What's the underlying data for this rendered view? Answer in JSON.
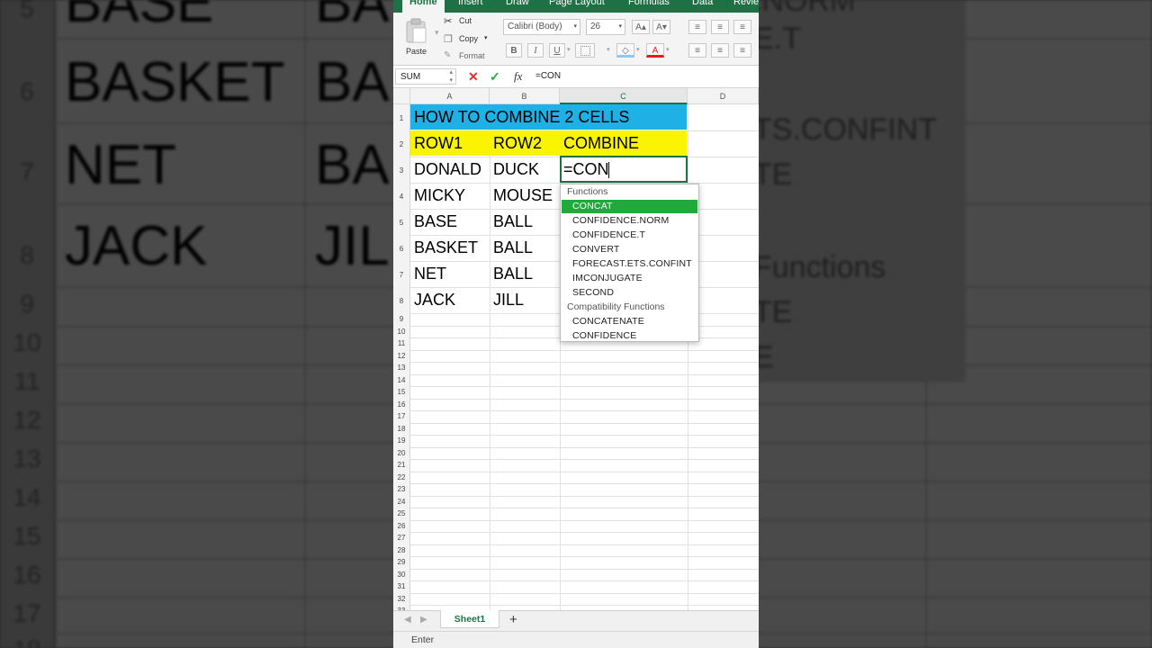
{
  "ribbon": {
    "tabs": [
      "Home",
      "Insert",
      "Draw",
      "Page Layout",
      "Formulas",
      "Data",
      "Revie"
    ],
    "active_tab": "Home",
    "paste_label": "Paste",
    "cut_label": "Cut",
    "copy_label": "Copy",
    "format_label": "Format",
    "font_name": "Calibri (Body)",
    "font_size": "26",
    "bold": "B",
    "italic": "I",
    "underline": "U",
    "grow_font": "A",
    "shrink_font": "A"
  },
  "formula_bar": {
    "name_box": "SUM",
    "cancel_icon": "✕",
    "enter_icon": "✓",
    "fx_label": "fx",
    "content": "=CON"
  },
  "grid": {
    "columns": [
      "A",
      "B",
      "C",
      "D"
    ],
    "selected_column": "C",
    "row_numbers": [
      "1",
      "2",
      "3",
      "4",
      "5",
      "6",
      "7",
      "8",
      "9",
      "10",
      "11",
      "12",
      "13",
      "14",
      "15",
      "16",
      "17",
      "18",
      "19",
      "20",
      "21",
      "22",
      "23",
      "24",
      "25",
      "26",
      "27",
      "28",
      "29",
      "30",
      "31",
      "32",
      "33"
    ],
    "title": "HOW TO COMBINE 2 CELLS",
    "header": [
      "ROW1",
      "ROW2",
      "COMBINE"
    ],
    "rows": [
      [
        "DONALD",
        "DUCK"
      ],
      [
        "MICKY",
        "MOUSE"
      ],
      [
        "BASE",
        "BALL"
      ],
      [
        "BASKET",
        "BALL"
      ],
      [
        "NET",
        "BALL"
      ],
      [
        "JACK",
        "JILL"
      ]
    ],
    "active_cell_text": "=CON"
  },
  "autocomplete": {
    "functions_header": "Functions",
    "functions": [
      "CONCAT",
      "CONFIDENCE.NORM",
      "CONFIDENCE.T",
      "CONVERT",
      "FORECAST.ETS.CONFINT",
      "IMCONJUGATE",
      "SECOND"
    ],
    "selected": "CONCAT",
    "compat_header": "Compatibility Functions",
    "compat_functions": [
      "CONCATENATE",
      "CONFIDENCE"
    ]
  },
  "sheet_tabs": {
    "active": "Sheet1",
    "add_label": "+"
  },
  "status_bar": {
    "mode": "Enter"
  },
  "background": {
    "row_numbers": [
      "5",
      "6",
      "7",
      "8",
      "9",
      "10",
      "11",
      "12",
      "13",
      "14",
      "15",
      "16",
      "17",
      "18"
    ],
    "col_a": [
      "BASE",
      "BASKET",
      "NET",
      "JACK"
    ],
    "col_b": [
      "BA",
      "BA",
      "BA",
      "JIL"
    ],
    "right_text": [
      ".NORM",
      "E.T",
      "TS.CONFINT",
      "TE",
      "Functions",
      "TE",
      "E"
    ]
  },
  "colors": {
    "ribbon_green": "#1e7145",
    "title_fill": "#1fb0e6",
    "header_fill": "#fbf400",
    "autocomplete_selected": "#22a93c"
  }
}
